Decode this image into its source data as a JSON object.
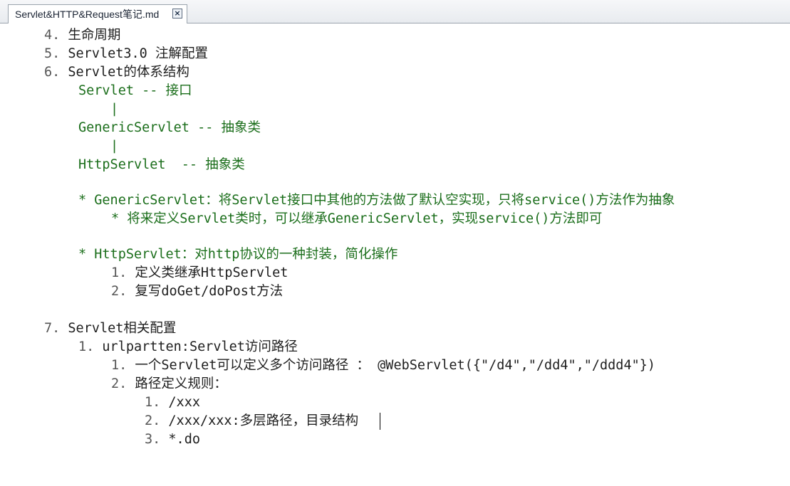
{
  "tab": {
    "title": "Servlet&HTTP&Request笔记.md",
    "close_glyph": "×"
  },
  "lines": [
    {
      "num": "4. ",
      "text": "生命周期"
    },
    {
      "num": "5. ",
      "text": "Servlet3.0 注解配置"
    },
    {
      "num": "6. ",
      "text": "Servlet的体系结构"
    },
    {
      "num": "",
      "text": "Servlet -- 接口"
    },
    {
      "num": "",
      "text": "|"
    },
    {
      "num": "",
      "text": "GenericServlet -- 抽象类"
    },
    {
      "num": "",
      "text": "|"
    },
    {
      "num": "",
      "text": "HttpServlet  -- 抽象类"
    },
    {
      "num": "",
      "text": "* GenericServlet：将Servlet接口中其他的方法做了默认空实现，只将service()方法作为抽象"
    },
    {
      "num": "",
      "text": "* 将来定义Servlet类时，可以继承GenericServlet，实现service()方法即可"
    },
    {
      "num": "",
      "text": "* HttpServlet：对http协议的一种封装，简化操作"
    },
    {
      "num": "1. ",
      "text": "定义类继承HttpServlet"
    },
    {
      "num": "2. ",
      "text": "复写doGet/doPost方法"
    },
    {
      "num": "7. ",
      "text": "Servlet相关配置"
    },
    {
      "num": "1. ",
      "text": "urlpartten:Servlet访问路径"
    },
    {
      "num": "1. ",
      "text": "一个Servlet可以定义多个访问路径 ： @WebServlet({\"/d4\",\"/dd4\",\"/ddd4\"})"
    },
    {
      "num": "2. ",
      "text": "路径定义规则："
    },
    {
      "num": "1. ",
      "text": "/xxx"
    },
    {
      "num": "2. ",
      "text": "/xxx/xxx:多层路径，目录结构"
    },
    {
      "num": "3. ",
      "text": "*.do"
    }
  ]
}
